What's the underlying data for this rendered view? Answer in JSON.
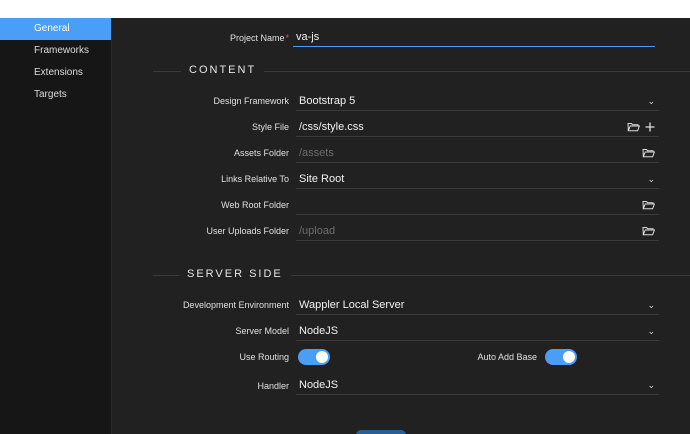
{
  "sidebar": {
    "items": [
      {
        "label": "General"
      },
      {
        "label": "Frameworks"
      },
      {
        "label": "Extensions"
      },
      {
        "label": "Targets"
      }
    ]
  },
  "project": {
    "label": "Project Name",
    "required_mark": "*",
    "value": "va-js"
  },
  "sections": {
    "content": "CONTENT",
    "server": "SERVER SIDE"
  },
  "content": {
    "design_framework": {
      "label": "Design Framework",
      "value": "Bootstrap 5"
    },
    "style_file": {
      "label": "Style File",
      "value": "/css/style.css"
    },
    "assets_folder": {
      "label": "Assets Folder",
      "placeholder": "/assets"
    },
    "links_relative": {
      "label": "Links Relative To",
      "value": "Site Root"
    },
    "web_root": {
      "label": "Web Root Folder",
      "value": ""
    },
    "uploads_folder": {
      "label": "User Uploads Folder",
      "placeholder": "/upload"
    }
  },
  "server": {
    "dev_env": {
      "label": "Development Environment",
      "value": "Wappler Local Server"
    },
    "server_model": {
      "label": "Server Model",
      "value": "NodeJS"
    },
    "use_routing": {
      "label": "Use Routing",
      "on": true
    },
    "auto_add_base": {
      "label": "Auto Add Base",
      "on": true
    },
    "handler": {
      "label": "Handler",
      "value": "NodeJS"
    }
  },
  "colors": {
    "accent": "#4a9ef6",
    "required": "#e0534f"
  },
  "icons": {
    "folder": "folder-open-icon",
    "plus": "plus-icon",
    "chevron": "chevron-down-icon"
  }
}
